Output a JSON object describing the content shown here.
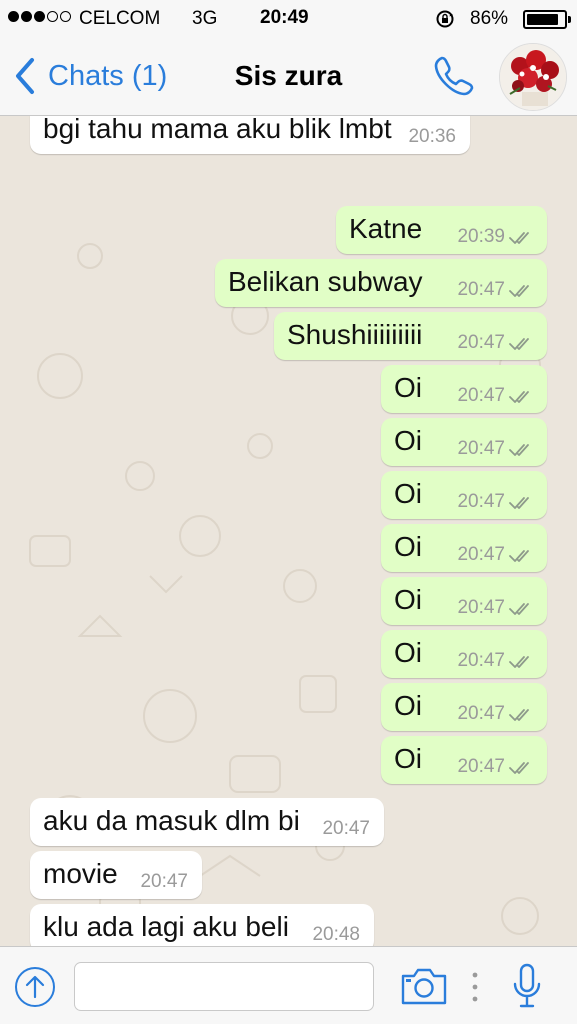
{
  "status_bar": {
    "carrier": "CELCOM",
    "network": "3G",
    "time": "20:49",
    "battery": "86%",
    "battery_level": 0.86,
    "signal_bars_filled": 3,
    "signal_bars_total": 5
  },
  "nav": {
    "back_label": "Chats (1)",
    "contact_name": "Sis zura"
  },
  "messages": [
    {
      "direction": "in",
      "text": "bgi tahu mama aku blik lmbt",
      "time": "20:36"
    },
    {
      "direction": "out",
      "text": "Katne",
      "time": "20:39"
    },
    {
      "direction": "out",
      "text": "Belikan subway",
      "time": "20:47"
    },
    {
      "direction": "out",
      "text": "Shushiiiiiiiii",
      "time": "20:47"
    },
    {
      "direction": "out",
      "text": "Oi",
      "time": "20:47"
    },
    {
      "direction": "out",
      "text": "Oi",
      "time": "20:47"
    },
    {
      "direction": "out",
      "text": "Oi",
      "time": "20:47"
    },
    {
      "direction": "out",
      "text": "Oi",
      "time": "20:47"
    },
    {
      "direction": "out",
      "text": "Oi",
      "time": "20:47"
    },
    {
      "direction": "out",
      "text": "Oi",
      "time": "20:47"
    },
    {
      "direction": "out",
      "text": "Oi",
      "time": "20:47"
    },
    {
      "direction": "out",
      "text": "Oi",
      "time": "20:47"
    },
    {
      "direction": "in",
      "text": "aku da masuk dlm bi",
      "time": "20:47"
    },
    {
      "direction": "in",
      "text": "movie",
      "time": "20:47"
    },
    {
      "direction": "in",
      "text": "klu ada lagi aku beli",
      "time": "20:48"
    }
  ],
  "input": {
    "value": "",
    "placeholder": ""
  },
  "colors": {
    "accent": "#2a7ddb",
    "outgoing_bubble": "#e1fec6",
    "incoming_bubble": "#ffffff",
    "chat_background": "#ebe5dc",
    "read_ticks": "#8e9a8b"
  },
  "icons": {
    "back": "chevron-left-icon",
    "call": "phone-icon",
    "upload": "upload-arrow-icon",
    "camera": "camera-icon",
    "more": "vertical-dots-icon",
    "mic": "microphone-icon",
    "ticks": "double-check-icon"
  }
}
